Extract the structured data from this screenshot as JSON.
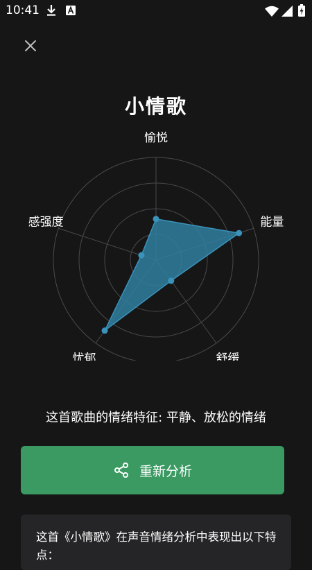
{
  "status_bar": {
    "time": "10:41",
    "icons": [
      "download-icon",
      "a-notification-icon",
      "wifi-icon",
      "signal-icon",
      "battery-charging-icon"
    ]
  },
  "close_icon": "close-icon",
  "song_title": "小情歌",
  "chart_data": {
    "type": "radar",
    "axes": [
      "愉悦",
      "能量",
      "舒缓",
      "忧郁",
      "情感强度"
    ],
    "values": [
      0.4,
      0.85,
      0.25,
      0.85,
      0.15
    ],
    "rings": 4,
    "fill_color": "#2f7fa0",
    "point_color": "#3a93bb"
  },
  "summary": "这首歌曲的情绪特征: 平静、放松的情绪",
  "reanalyze_button": {
    "label": "重新分析",
    "icon": "share-icon",
    "color": "#3a9a62"
  },
  "analysis_card": {
    "text": "这首《小情歌》在声音情绪分析中表现出以下特点："
  }
}
